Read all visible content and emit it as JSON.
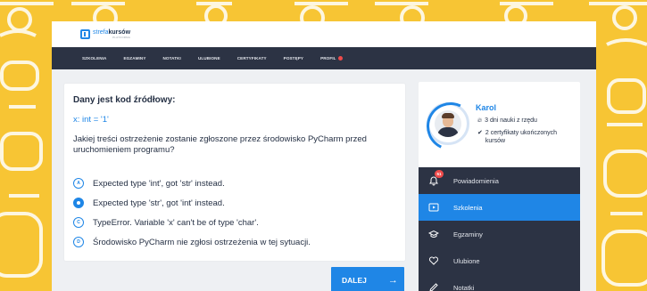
{
  "colors": {
    "accent": "#1f86e6",
    "background": "#f7c534",
    "nav": "#2c3344",
    "alert": "#ef4b4b"
  },
  "brand": {
    "name_prefix": "strefa",
    "name_bold": "kursów",
    "sub": "PLATFORMA",
    "icon": "logo-mark-icon"
  },
  "nav": {
    "items": [
      "SZKOLENIA",
      "EGZAMINY",
      "NOTATKI",
      "ULUBIONE",
      "CERTYFIKATY",
      "POSTĘPY",
      "PROFIL"
    ]
  },
  "question": {
    "title": "Dany jest kod źródłowy:",
    "code": "x: int = '1'",
    "text": "Jakiej treści ostrzeżenie zostanie zgłoszone przez środowisko PyCharm przed uruchomieniem programu?",
    "options": [
      {
        "letter": "A",
        "text": "Expected type 'int', got 'str' instead.",
        "selected": false
      },
      {
        "letter": "B",
        "text": "Expected type 'str', got 'int' instead.",
        "selected": true
      },
      {
        "letter": "C",
        "text": "TypeError. Variable 'x' can't be of type 'char'.",
        "selected": false
      },
      {
        "letter": "D",
        "text": "Środowisko PyCharm nie zgłosi ostrzeżenia w tej sytuacji.",
        "selected": false
      }
    ],
    "next_label": "DALEJ",
    "next_icon": "arrow-right-icon"
  },
  "profile": {
    "name": "Karol",
    "streak": "3 dni nauki z rzędu",
    "streak_icon": "flame-icon",
    "certs": "2 certyfikaty ukończonych kursów",
    "certs_icon": "check-badge-icon"
  },
  "menu": {
    "items": [
      {
        "label": "Powiadomienia",
        "icon": "bell-icon",
        "badge": "51"
      },
      {
        "label": "Szkolenia",
        "icon": "video-icon",
        "active": true
      },
      {
        "label": "Egzaminy",
        "icon": "graduation-cap-icon"
      },
      {
        "label": "Ulubione",
        "icon": "heart-icon"
      },
      {
        "label": "Notatki",
        "icon": "pencil-icon"
      }
    ]
  }
}
